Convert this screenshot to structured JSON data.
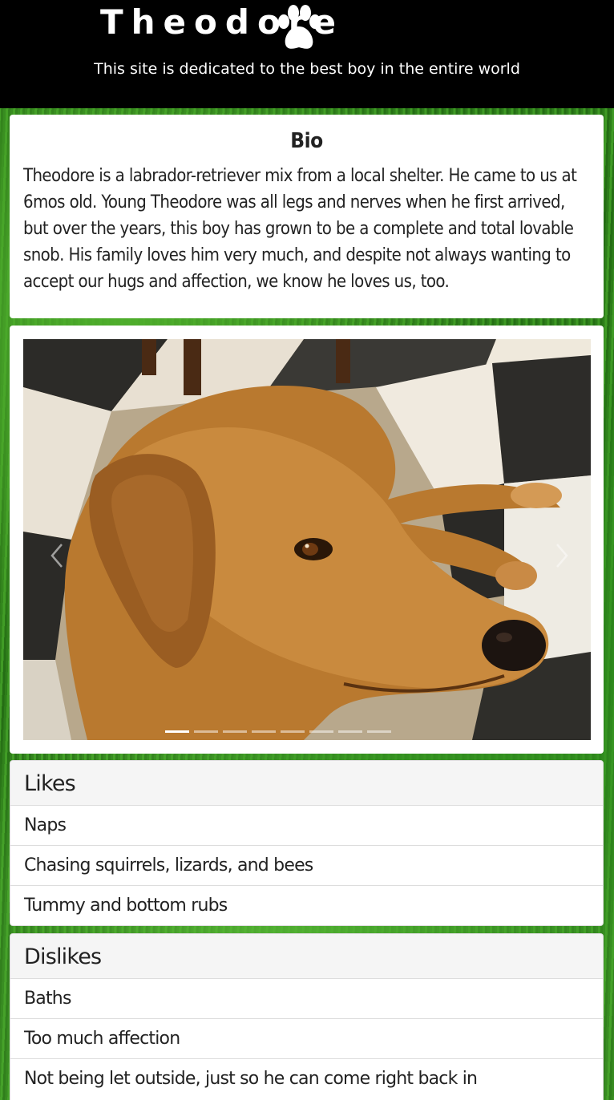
{
  "header": {
    "site_title": "Theodore",
    "tagline": "This site is dedicated to the best boy in the entire world"
  },
  "bio": {
    "heading": "Bio",
    "text": "Theodore is a labrador-retriever mix from a local shelter. He came to us at 6mos old. Young Theodore was all legs and nerves when he first arrived, but over the years, this boy has grown to be a complete and total lovable snob. His family loves him very much, and despite not always wanting to accept our hugs and affection, we know he loves us, too."
  },
  "carousel": {
    "slide_count": 8,
    "active_index": 0,
    "prev_icon": "chevron-left-icon",
    "next_icon": "chevron-right-icon"
  },
  "likes": {
    "heading": "Likes",
    "items": [
      "Naps",
      "Chasing squirrels, lizards, and bees",
      "Tummy and bottom rubs"
    ]
  },
  "dislikes": {
    "heading": "Dislikes",
    "items": [
      "Baths",
      "Too much affection",
      "Not being let outside, just so he can come right back in"
    ]
  },
  "colors": {
    "header_bg": "#000000",
    "background": "#2f8a1c",
    "panel_bg": "#ffffff",
    "list_head_bg": "#f5f5f5"
  }
}
